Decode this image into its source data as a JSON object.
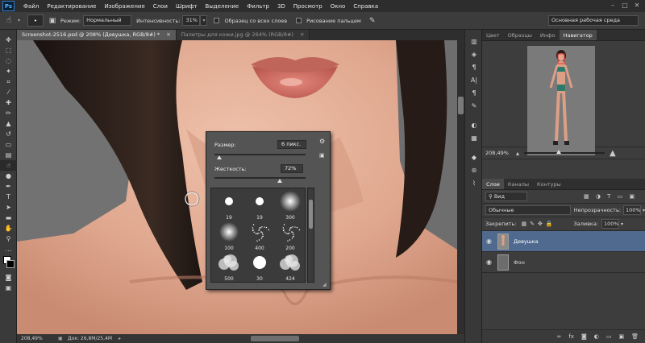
{
  "app": {
    "logo": "Ps"
  },
  "menu": [
    "Файл",
    "Редактирование",
    "Изображение",
    "Слои",
    "Шрифт",
    "Выделение",
    "Фильтр",
    "3D",
    "Просмотр",
    "Окно",
    "Справка"
  ],
  "options": {
    "mode_label": "Режим:",
    "mode_value": "Нормальный",
    "intensity_label": "Интенсивность:",
    "intensity_value": "31%",
    "sample_all_layers": "Образец со всех слоев",
    "finger_painting": "Рисование пальцем",
    "workspace": "Основная рабочая среда"
  },
  "tabs": [
    {
      "label": "Screenshot-2516.psd @ 208% (Девушка, RGB/8#) *",
      "active": true
    },
    {
      "label": "Палитры для кожи.jpg @ 264% (RGB/8#)",
      "active": false
    }
  ],
  "status": {
    "zoom": "208,49%",
    "doc": "Док: 26,8M/25,4M"
  },
  "brush_popup": {
    "size_label": "Размер:",
    "size_value": "6 пикс.",
    "size_fraction": 0.05,
    "hardness_label": "Жесткость:",
    "hardness_value": "72%",
    "hardness_fraction": 0.72,
    "presets": [
      {
        "size": "19",
        "kind": "hard-small"
      },
      {
        "size": "19",
        "kind": "hard-small"
      },
      {
        "size": "300",
        "kind": "soft-large"
      },
      {
        "size": "100",
        "kind": "soft-medium"
      },
      {
        "size": "400",
        "kind": "spatter"
      },
      {
        "size": "200",
        "kind": "spatter"
      },
      {
        "size": "500",
        "kind": "cloud"
      },
      {
        "size": "30",
        "kind": "hard-large"
      },
      {
        "size": "424",
        "kind": "cloud"
      }
    ]
  },
  "navigator": {
    "tabs": [
      {
        "label": "Цвет",
        "active": false
      },
      {
        "label": "Образцы",
        "active": false
      },
      {
        "label": "Инфо",
        "active": false
      },
      {
        "label": "Навигатор",
        "active": true
      }
    ],
    "zoom": "208,49%"
  },
  "layers_panel": {
    "tabs": [
      {
        "label": "Слои",
        "active": true
      },
      {
        "label": "Каналы",
        "active": false
      },
      {
        "label": "Контуры",
        "active": false
      }
    ],
    "filter": "Вид",
    "blend_mode": "Обычные",
    "opacity_label": "Непрозрачность:",
    "opacity_value": "100%",
    "lock_label": "Закрепить:",
    "fill_label": "Заливка:",
    "fill_value": "100%",
    "layers": [
      {
        "name": "Девушка",
        "selected": true
      },
      {
        "name": "Фон",
        "selected": false
      }
    ],
    "footer_icons": [
      "link-icon",
      "fx-icon",
      "mask-icon",
      "adjustment-icon",
      "group-icon",
      "new-layer-icon",
      "trash-icon"
    ]
  },
  "colors": {
    "accent": "#4f6a8e",
    "skin": "#e0ab93",
    "panel": "#3d3d3d"
  }
}
